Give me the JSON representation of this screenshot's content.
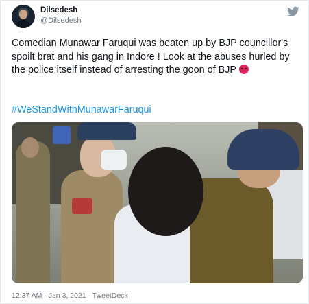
{
  "tweet": {
    "author_name": "Dilsedesh",
    "author_handle": "@Dilsedesh",
    "text": "Comedian Munawar Faruqui was beaten up by BJP councillor's spoilt brat and his gang in  Indore  ! Look at the abuses hurled by the police itself instead of arresting the goon of BJP",
    "emoji": "angry-face-icon",
    "hashtag": "#WeStandWithMunawarFaruqui",
    "time": "12:37 AM",
    "separator1": " · ",
    "date": "Jan 3, 2021",
    "separator2": " · ",
    "source": "TweetDeck"
  },
  "colors": {
    "link": "#1b95e0",
    "muted": "#6e767d",
    "twitter_icon": "#8899a6",
    "emoji": "#e0245e"
  },
  "icons": {
    "brand": "twitter-bird-icon"
  }
}
